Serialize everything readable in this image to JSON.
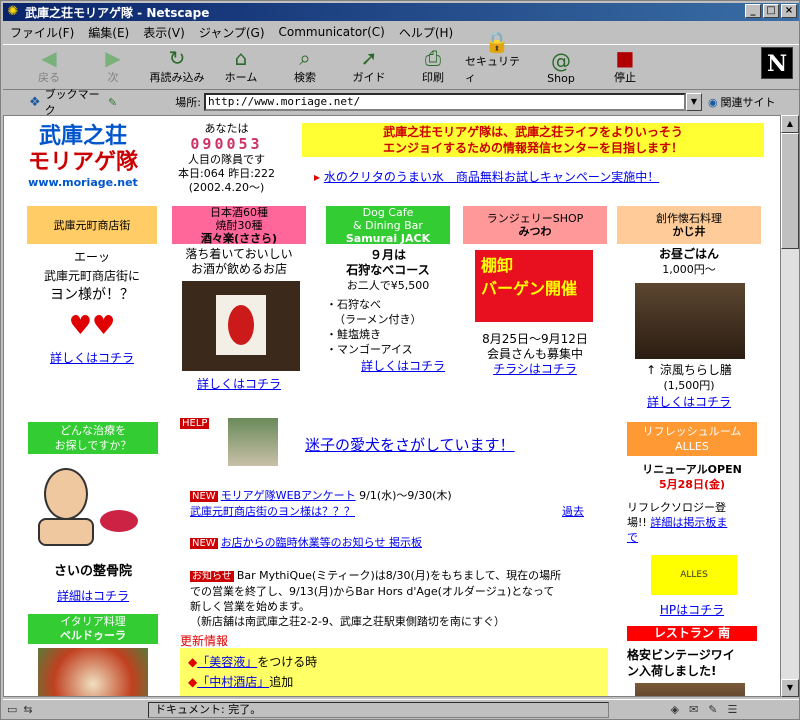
{
  "window": {
    "title": "武庫之荘モリアゲ隊 - Netscape"
  },
  "menu": [
    "ファイル(F)",
    "編集(E)",
    "表示(V)",
    "ジャンプ(G)",
    "Communicator(C)",
    "ヘルプ(H)"
  ],
  "toolbar": [
    {
      "label": "戻る",
      "icon": "◀"
    },
    {
      "label": "次",
      "icon": "▶"
    },
    {
      "label": "再読み込み",
      "icon": "↻"
    },
    {
      "label": "ホーム",
      "icon": "⌂"
    },
    {
      "label": "検索",
      "icon": "⌕"
    },
    {
      "label": "ガイド",
      "icon": "➚"
    },
    {
      "label": "印刷",
      "icon": "⎙"
    },
    {
      "label": "セキュリティ",
      "icon": "🔒"
    },
    {
      "label": "Shop",
      "icon": "@"
    },
    {
      "label": "停止",
      "icon": "■"
    }
  ],
  "netscape_logo": "N",
  "location": {
    "bookmark": "ブックマーク",
    "label": "場所:",
    "url": "http://www.moriage.net/",
    "related": "関連サイト"
  },
  "site": {
    "logo_line1": "武庫之荘",
    "logo_line2": "モリアゲ隊",
    "logo_url": "www.moriage.net",
    "counter_prefix": "あなたは",
    "counter": "090053",
    "counter_suffix": "人目の隊員です",
    "today": "本日:064 昨日:222",
    "since": "(2002.4.20〜)",
    "banner1": "武庫之荘モリアゲ隊は、武庫之荘ライフをよりいっそう",
    "banner2": "エンジョイするための情報発信センターを目指します！",
    "campaign": "水のクリタのうまい水　商品無料お試しキャンペーン実施中！"
  },
  "shops": [
    {
      "h1": "武庫元町商店街",
      "h2": "",
      "t1": "エーッ",
      "t2": "武庫元町商店街に",
      "t3": "ヨン様が！？",
      "link": "詳しくはコチラ"
    },
    {
      "h1": "日本酒60種",
      "h2": "焼酎30種",
      "h3": "酒々楽(ささら)",
      "t1": "落ち着いておいしい",
      "t2": "お酒が飲めるお店",
      "link": "詳しくはコチラ"
    },
    {
      "h1": "Dog Cafe",
      "h2": "& Dining Bar",
      "h3": "Samurai JACK",
      "t1": "９月は",
      "t2": "石狩なべコース",
      "t3": "お二人で¥5,500",
      "items": [
        "・石狩なべ",
        "（ラーメン付き）",
        "・鮭塩焼き",
        "・マンゴーアイス"
      ],
      "link": "詳しくはコチラ"
    },
    {
      "h1": "ランジェリーSHOP",
      "h2": "みつわ",
      "sale1": "棚卸",
      "sale2": "バーゲン開催",
      "t1": "8月25日〜9月12日",
      "t2": "会員さんも募集中",
      "link": "チラシはコチラ"
    },
    {
      "h1": "創作懐石料理",
      "h2": "かじ井",
      "t1": "お昼ごはん",
      "t2": "1,000円〜",
      "t3": "↑ 涼風ちらし膳",
      "t4": "(1,500円)",
      "link": "詳しくはコチラ"
    }
  ],
  "left": {
    "q1": "どんな治療を",
    "q2": "お探しですか？",
    "name": "さいの整骨院",
    "link": "詳細はコチラ",
    "it1": "イタリア料理",
    "it2": "ベルドゥーラ"
  },
  "center": {
    "help": "HELP",
    "lostdog": "迷子の愛犬をさがしています！",
    "new_label": "NEW",
    "notice_label": "お知らせ",
    "news1": "モリアゲ隊WEBアンケート",
    "news1_date": "9/1(水)〜9/30(木)",
    "news2": "武庫元町商店街のヨン様は？？？",
    "past": "過去",
    "news3": "お店からの臨時休業等のお知らせ 掲示板",
    "notice1": "Bar MythiQue(ミティーク)は8/30(月)をもちまして、現在の場所",
    "notice2": "での営業を終了し、9/13(月)からBar Hors d'Age(オルダージュ)となって",
    "notice3": "新しく営業を始めます。",
    "notice4": "（新店舗は南武庫之荘2-2-9、武庫之荘駅東側踏切を南にすぐ）",
    "update_title": "更新情報",
    "upd1_link": "「美容液」",
    "upd1": "をつける時",
    "upd2_link": "「中村酒店」",
    "upd2": "追加"
  },
  "right": {
    "r1": "リフレッシュルーム",
    "r2": "ALLES",
    "open1": "リニューアルOPEN",
    "open2": "5月28日(金)",
    "t1": "リフレクソロジー登",
    "t2": "場!!",
    "link1": "詳細は掲示板ま",
    "t3": "で",
    "alles": "ALLES",
    "hp": "HPはコチラ",
    "rest": "レストラン 南",
    "w1": "格安ビンテージワイ",
    "w2": "ン入荷しました!"
  },
  "status": {
    "msg": "ドキュメント: 完了。"
  }
}
